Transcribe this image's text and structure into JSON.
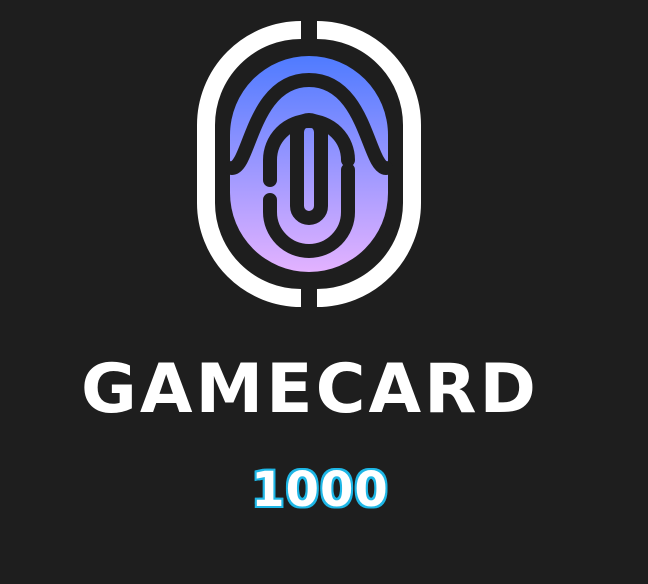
{
  "brand": {
    "name": "GAMECARD",
    "logo_icon": "fingerprint-icon"
  },
  "card": {
    "value": "1000"
  },
  "colors": {
    "background": "#1e1e1e",
    "text": "#ffffff",
    "gradient_top": "#4f7bff",
    "gradient_bottom": "#e3b2ff",
    "value_outline": "#1fb7e6"
  }
}
